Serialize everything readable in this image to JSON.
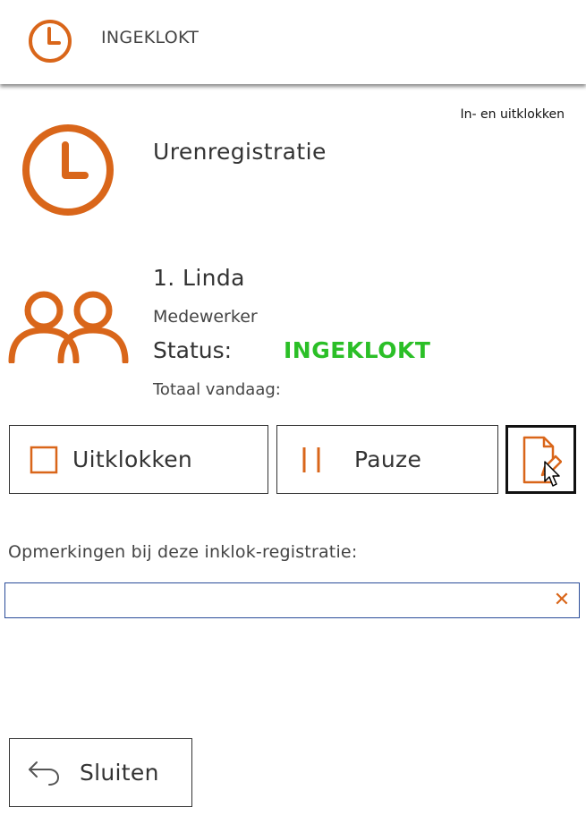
{
  "header": {
    "title": "INGEKLOKT",
    "icon": "clock-icon"
  },
  "breadcrumb": "In- en uitklokken",
  "section": {
    "title": "Urenregistratie",
    "icon": "clock-icon"
  },
  "employee": {
    "name": "1. Linda",
    "role": "Medewerker",
    "status_label": "Status:",
    "status_value": "INGEKLOKT",
    "today_label": "Totaal vandaag:",
    "icon": "users-icon"
  },
  "actions": {
    "clock_out_label": "Uitklokken",
    "pause_label": "Pauze",
    "document_icon": "document-edit-icon"
  },
  "remarks": {
    "label": "Opmerkingen bij deze inklok-registratie:",
    "value": "",
    "clear_glyph": "✕"
  },
  "footer": {
    "close_label": "Sluiten",
    "icon": "back-arrow-icon"
  },
  "colors": {
    "accent": "#d9661a",
    "status_green": "#2bbf27",
    "input_border": "#2a4c99"
  }
}
